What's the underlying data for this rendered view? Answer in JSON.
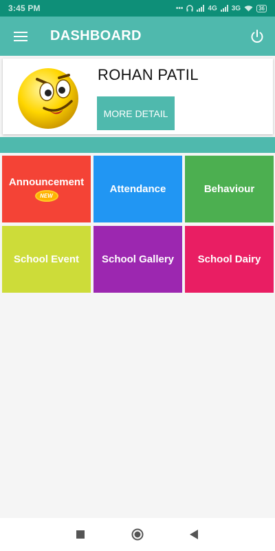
{
  "status_bar": {
    "time": "3:45 PM",
    "network_1": "4G",
    "network_2": "3G",
    "battery": "36"
  },
  "app_bar": {
    "title": "DASHBOARD",
    "menu_icon": "hamburger-menu-icon",
    "power_icon": "power-icon"
  },
  "profile": {
    "name": "ROHAN PATIL",
    "more_detail_label": "MORE DETAIL",
    "avatar_icon": "smiley-emoji-avatar"
  },
  "tiles": [
    {
      "label": "Announcement",
      "color": "#f44336",
      "badge": "NEW"
    },
    {
      "label": "Attendance",
      "color": "#2196f3"
    },
    {
      "label": "Behaviour",
      "color": "#4caf50"
    },
    {
      "label": "School Event",
      "color": "#cddc39"
    },
    {
      "label": "School Gallery",
      "color": "#9c27b0"
    },
    {
      "label": "School Dairy",
      "color": "#e91e63"
    }
  ],
  "colors": {
    "primary": "#4fb9ad",
    "status_bar": "#0e8f78"
  },
  "nav_bar": {
    "recents_icon": "square-recents-icon",
    "home_icon": "circle-home-icon",
    "back_icon": "triangle-back-icon"
  }
}
